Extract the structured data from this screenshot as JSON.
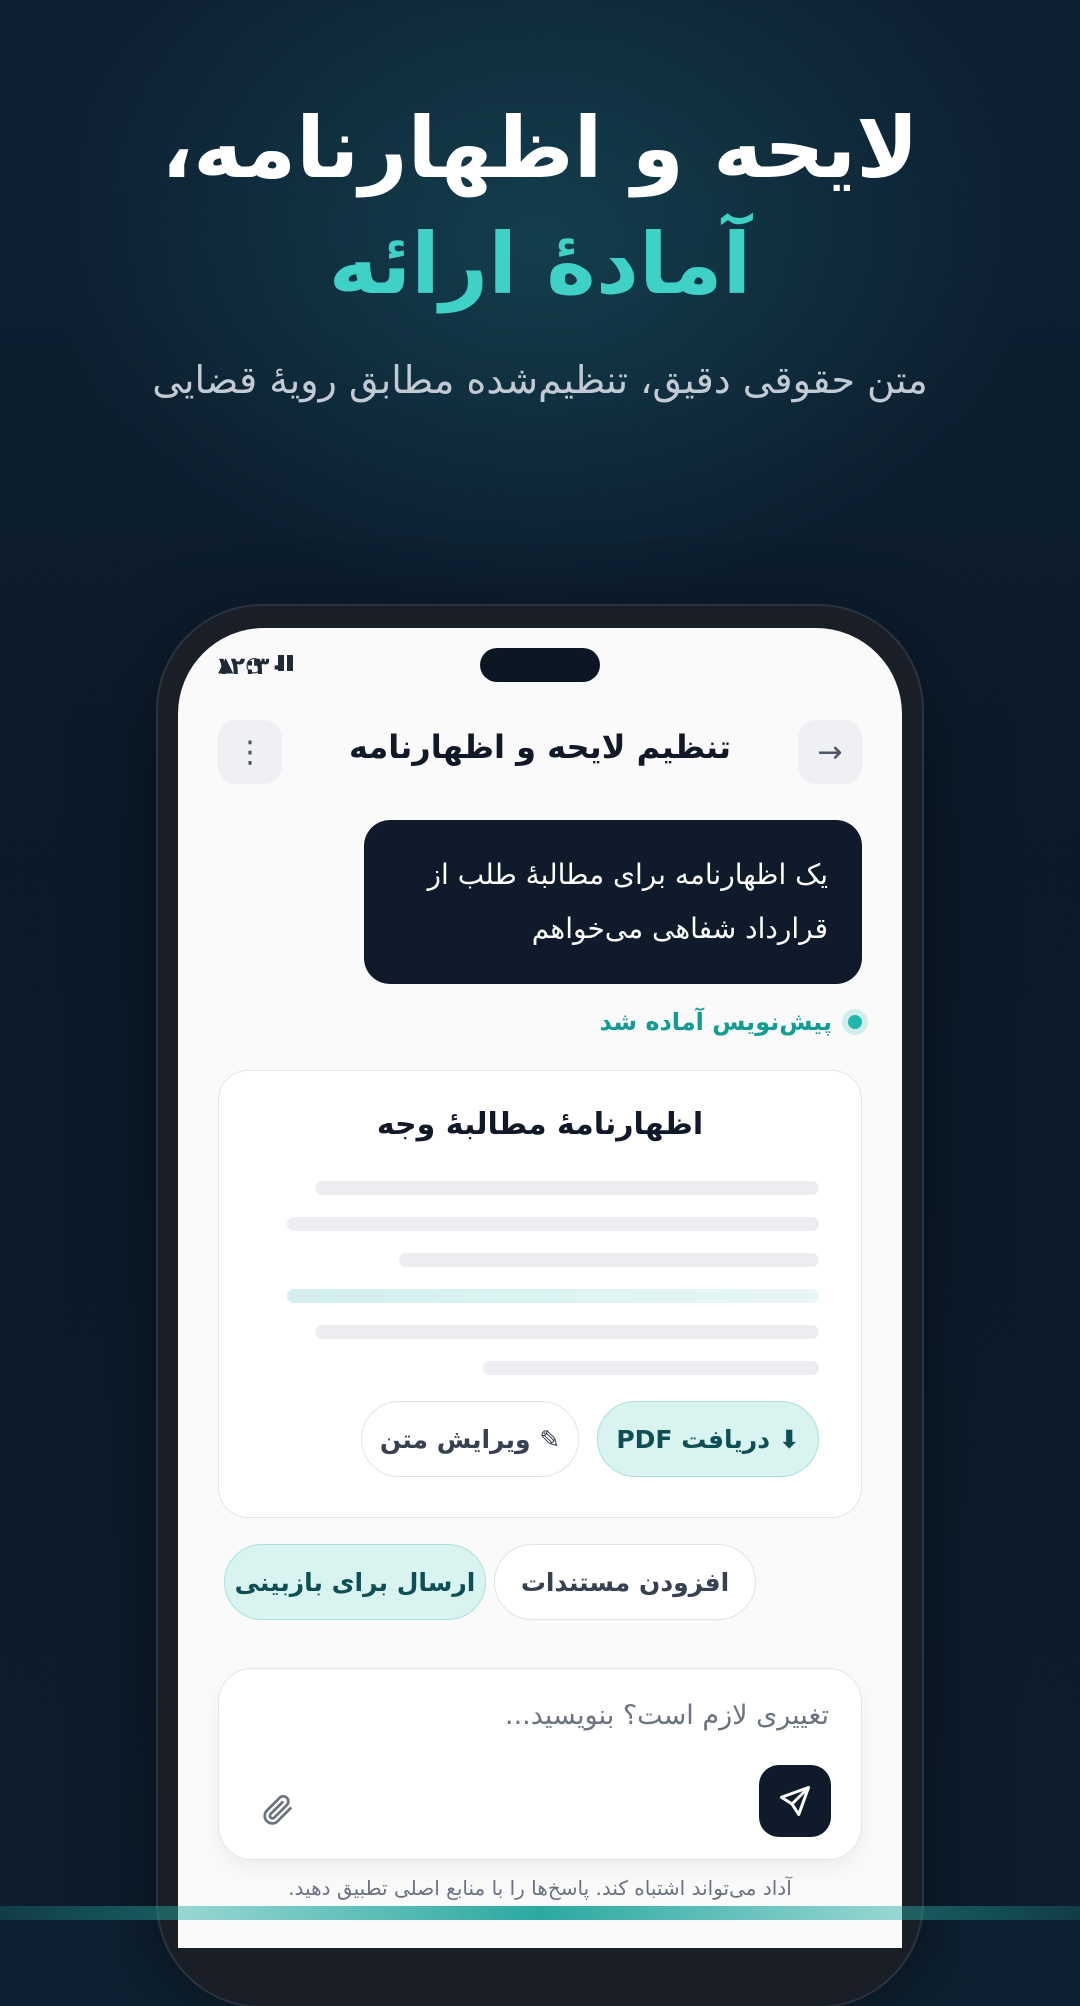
{
  "hero": {
    "title_line1": "لایحه و اظهارنامه،",
    "title_line2": "آمادهٔ ارائه",
    "subtitle": "متن حقوقی دقیق، تنظیم‌شده مطابق رویهٔ قضایی"
  },
  "status_bar": {
    "time": "۱۲:۳۰",
    "icons": [
      "signal-icon",
      "clock-icon",
      "battery-icon"
    ]
  },
  "topbar": {
    "title": "تنظیم لایحه و اظهارنامه",
    "back_icon": "→",
    "menu_icon": "⋮"
  },
  "chat": {
    "user_message": "یک اظهارنامه برای مطالبهٔ طلب از قرارداد شفاهی می‌خواهم",
    "status": "پیش‌نویس آماده شد"
  },
  "document": {
    "title": "اظهارنامهٔ مطالبهٔ وجه",
    "download_label": "⬇ دریافت PDF",
    "edit_label": "✎ ویرایش متن"
  },
  "suggestions": [
    {
      "label": "ارسال برای بازبینی"
    },
    {
      "label": "افزودن مستندات"
    }
  ],
  "composer": {
    "placeholder": "تغییری لازم است؟ بنویسید..."
  },
  "disclaimer": "آداد می‌تواند اشتباه کند. پاسخ‌ها را با منابع اصلی تطبیق دهید.",
  "colors": {
    "accent": "#3fd0c6",
    "dark_bubble": "#0f1b2b",
    "status_green": "#149c94"
  }
}
